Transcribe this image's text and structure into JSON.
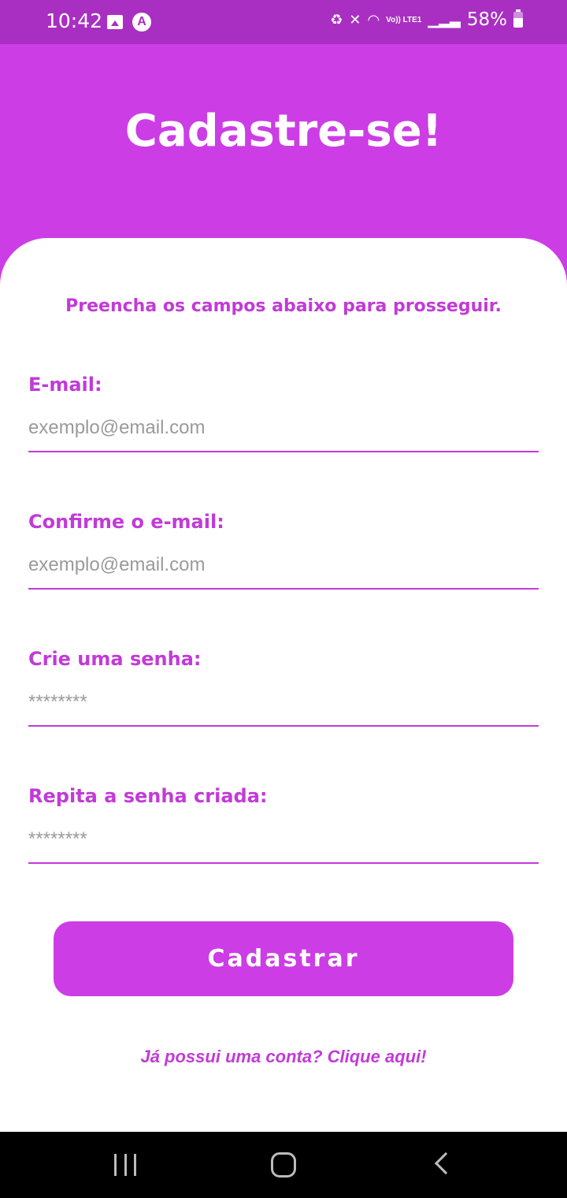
{
  "status_bar": {
    "time": "10:42",
    "lte_label": "Vo)) LTE1",
    "battery": "58%"
  },
  "header": {
    "title": "Cadastre-se!"
  },
  "form": {
    "subtitle": "Preencha os campos abaixo para prosseguir.",
    "fields": [
      {
        "label": "E-mail:",
        "placeholder": "exemplo@email.com"
      },
      {
        "label": "Confirme o e-mail:",
        "placeholder": "exemplo@email.com"
      },
      {
        "label": "Crie uma senha:",
        "placeholder": "********"
      },
      {
        "label": "Repita a senha criada:",
        "placeholder": "********"
      }
    ],
    "submit_label": "Cadastrar",
    "login_link": "Já possui uma conta? Clique aqui!"
  },
  "colors": {
    "accent": "#cc3de6",
    "status_bar": "#a92fc2",
    "label": "#c23ad8"
  }
}
